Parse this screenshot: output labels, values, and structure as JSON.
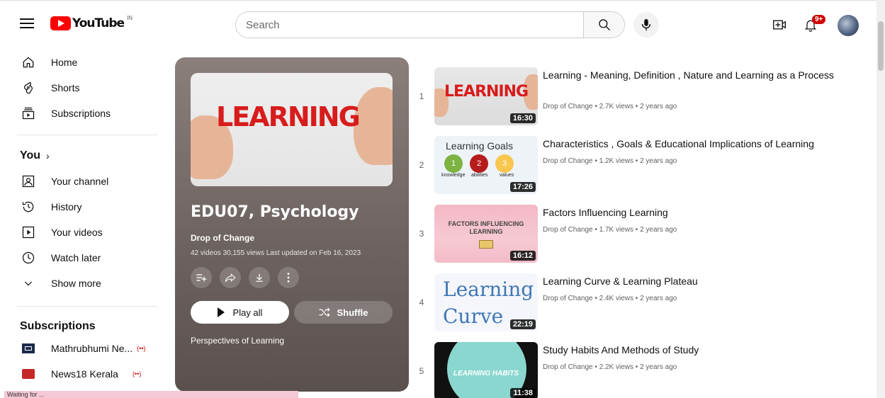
{
  "header": {
    "logo_text": "YouTube",
    "country_code": "IN",
    "search_placeholder": "Search",
    "notification_count": "9+"
  },
  "sidebar": {
    "items": [
      {
        "label": "Home",
        "icon": "home-icon"
      },
      {
        "label": "Shorts",
        "icon": "shorts-icon"
      },
      {
        "label": "Subscriptions",
        "icon": "subscriptions-icon"
      }
    ],
    "you_heading": "You",
    "you_items": [
      {
        "label": "Your channel",
        "icon": "your-channel-icon"
      },
      {
        "label": "History",
        "icon": "history-icon"
      },
      {
        "label": "Your videos",
        "icon": "your-videos-icon"
      },
      {
        "label": "Watch later",
        "icon": "watch-later-icon"
      },
      {
        "label": "Show more",
        "icon": "chevron-down-icon"
      }
    ],
    "subscriptions_heading": "Subscriptions",
    "subscriptions": [
      {
        "label": "Mathrubhumi Ne..."
      },
      {
        "label": "News18 Kerala"
      }
    ]
  },
  "playlist": {
    "title": "EDU07, Psychology",
    "thumb_word": "LEARNING",
    "channel": "Drop of Change",
    "meta": "42 videos  30,155 views  Last updated on Feb 16, 2023",
    "play_all_label": "Play all",
    "shuffle_label": "Shuffle",
    "description": "Perspectives of Learning"
  },
  "videos": [
    {
      "index": "1",
      "title": "Learning - Meaning, Definition , Nature and Learning as a Process",
      "meta": "Drop of Change • 2.7K views • 2 years ago",
      "duration": "16:30",
      "thumb_text": "LEARNING"
    },
    {
      "index": "2",
      "title": "Characteristics , Goals & Educational Implications of Learning",
      "meta": "Drop of Change • 1.2K views • 2 years ago",
      "duration": "17:26",
      "thumb_text": "Learning Goals"
    },
    {
      "index": "3",
      "title": "Factors Influencing Learning",
      "meta": "Drop of Change • 1.7K views • 2 years ago",
      "duration": "16:12",
      "thumb_text": "FACTORS INFLUENCING LEARNING"
    },
    {
      "index": "4",
      "title": "Learning Curve & Learning Plateau",
      "meta": "Drop of Change • 2.4K views • 2 years ago",
      "duration": "22:19",
      "thumb_text": "Learning Curve"
    },
    {
      "index": "5",
      "title": "Study Habits And Methods of Study",
      "meta": "Drop of Change • 2.2K views • 2 years ago",
      "duration": "11:38",
      "thumb_text": "LEARNING HABITS"
    }
  ],
  "thumb2": {
    "circles": [
      "1",
      "2",
      "3"
    ],
    "labels": [
      "knowledge",
      "abilities",
      "values"
    ]
  },
  "status_text": "Waiting for ...",
  "colors": {
    "brand_red": "#ff0000",
    "badge_red": "#cc0000",
    "panel_bg": "#6d6360"
  }
}
